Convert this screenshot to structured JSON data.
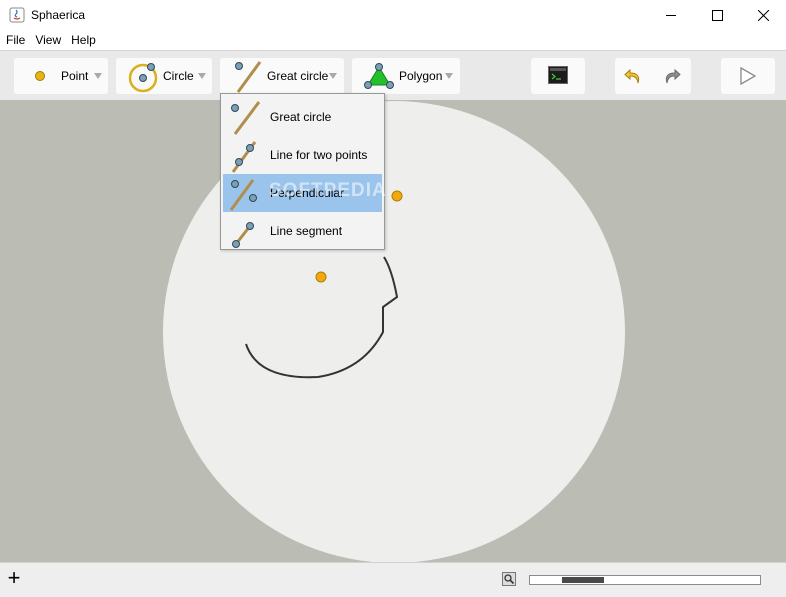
{
  "window": {
    "title": "Sphaerica"
  },
  "menu": [
    {
      "label": "File"
    },
    {
      "label": "View"
    },
    {
      "label": "Help"
    }
  ],
  "toolbar": {
    "point_label": "Point",
    "circle_label": "Circle",
    "greatcircle_label": "Great circle",
    "polygon_label": "Polygon"
  },
  "dropdown": {
    "items": [
      {
        "label": "Great circle"
      },
      {
        "label": "Line for two points"
      },
      {
        "label": "Perpendicular"
      },
      {
        "label": "Line segment"
      }
    ],
    "selected_index": 2
  },
  "watermark": "SOFTPEDIA",
  "statusbar": {
    "add_label": "+",
    "zoom_fraction": 0.17
  },
  "colors": {
    "point": "#f0a90f",
    "point_blue": "#7c9fb4",
    "canvas_bg": "#bbbdb4",
    "sphere": "#eeeeec",
    "selection": "#9ac4ec",
    "polygon_fill": "#22c12b"
  }
}
